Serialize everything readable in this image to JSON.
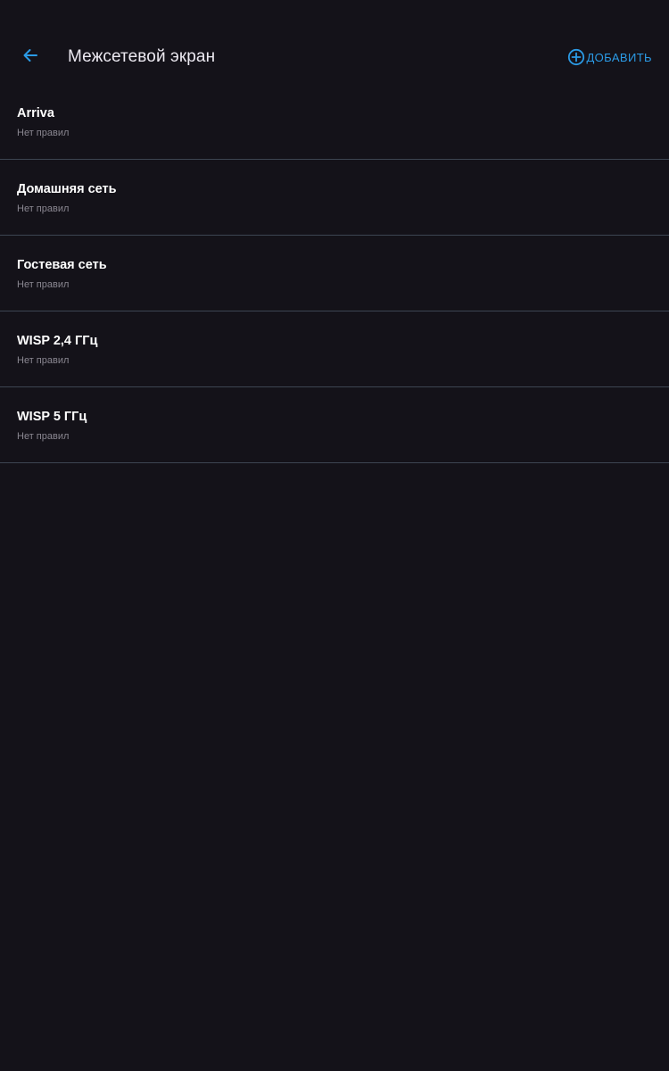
{
  "header": {
    "title": "Межсетевой экран",
    "add_label": "ДОБАВИТЬ",
    "back_icon": "arrow-left-icon",
    "add_icon": "plus-circle-icon"
  },
  "networks": [
    {
      "name": "Arriva",
      "status": "Нет правил"
    },
    {
      "name": "Домашняя сеть",
      "status": "Нет правил"
    },
    {
      "name": "Гостевая сеть",
      "status": "Нет правил"
    },
    {
      "name": "WISP 2,4 ГГц",
      "status": "Нет правил"
    },
    {
      "name": "WISP 5 ГГц",
      "status": "Нет правил"
    }
  ],
  "colors": {
    "background": "#141219",
    "accent": "#2b9be6",
    "divider": "#3d4552",
    "title_text": "#ffffff",
    "subtitle_text": "#8a8791"
  }
}
